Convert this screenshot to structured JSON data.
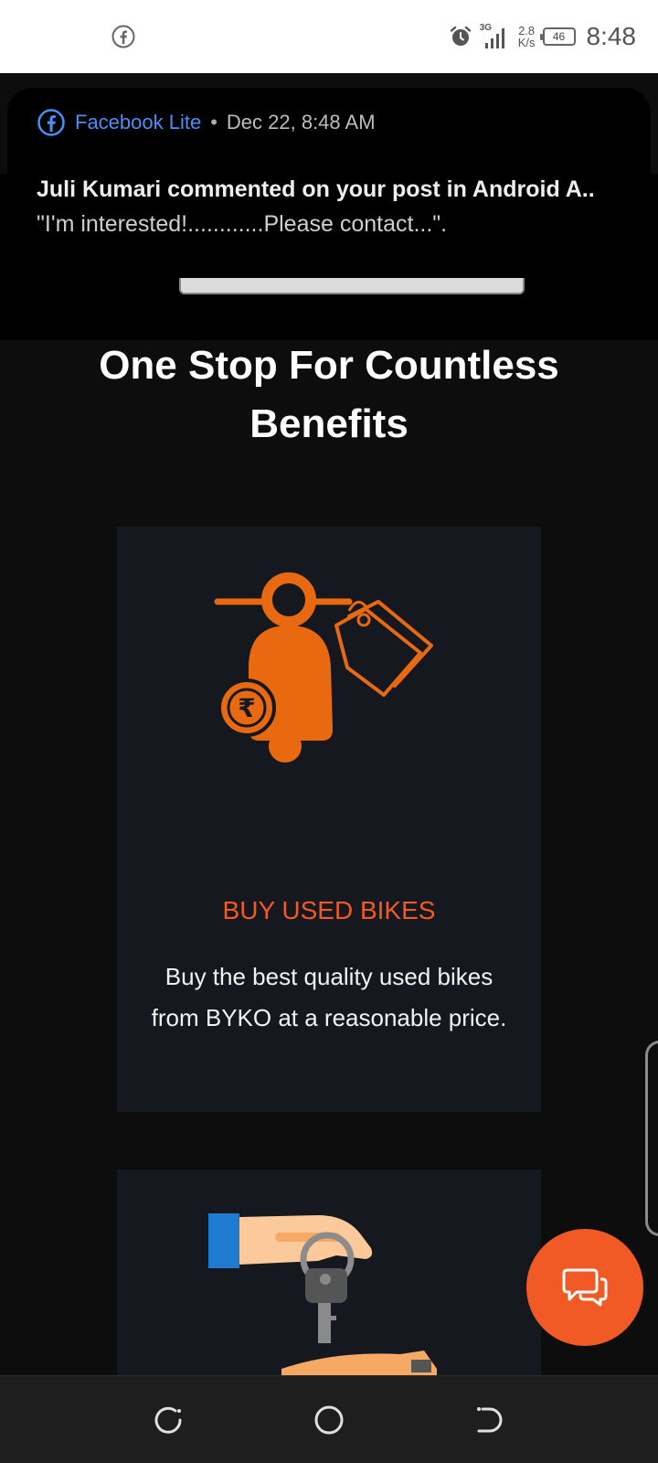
{
  "status_bar": {
    "network_speed_value": "2.8",
    "network_speed_unit": "K/s",
    "network_type": "3G",
    "battery": "46",
    "time": "8:48",
    "icons": [
      "facebook-icon",
      "alarm-icon",
      "signal-icon",
      "battery-icon"
    ]
  },
  "notification": {
    "app_name": "Facebook Lite",
    "separator": "•",
    "time": "Dec 22, 8:48 AM",
    "title": "Juli Kumari commented on your post in Android A..",
    "body": "\"I'm interested!............Please contact...\"."
  },
  "page": {
    "headline": "One Stop For Countless Benefits",
    "cards": [
      {
        "icon": "scooter-price-tag-icon",
        "title": "BUY USED BIKES",
        "description": "Buy the best quality used bikes from BYKO at a reasonable price."
      },
      {
        "icon": "hand-keys-icon"
      }
    ]
  },
  "chat_button": {
    "icon": "chat-bubbles-icon"
  },
  "nav_bar": {
    "buttons": [
      "recents-button",
      "home-button",
      "back-button"
    ]
  },
  "colors": {
    "accent": "#f15a24",
    "card_bg": "#161820",
    "page_bg": "#0d0d0d",
    "link_blue": "#4a8ff5"
  }
}
